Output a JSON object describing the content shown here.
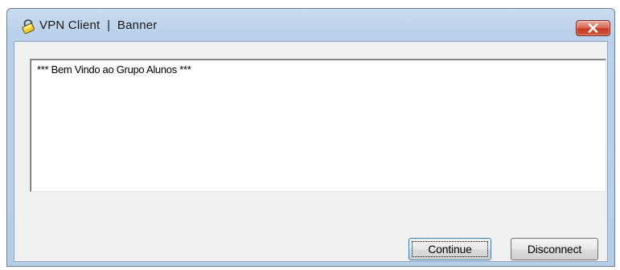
{
  "window": {
    "title": "VPN Client  |  Banner"
  },
  "banner": {
    "text": "*** Bem Vindo ao Grupo Alunos ***"
  },
  "buttons": {
    "continue_label": "Continue",
    "disconnect_label": "Disconnect"
  },
  "icons": {
    "app": "vpn-lock-icon",
    "close": "close-icon"
  },
  "colors": {
    "titlebar": "#b9d1ea",
    "close_button": "#c33b22",
    "client_area": "#f0f0f0",
    "banner_background": "#ffffff"
  }
}
